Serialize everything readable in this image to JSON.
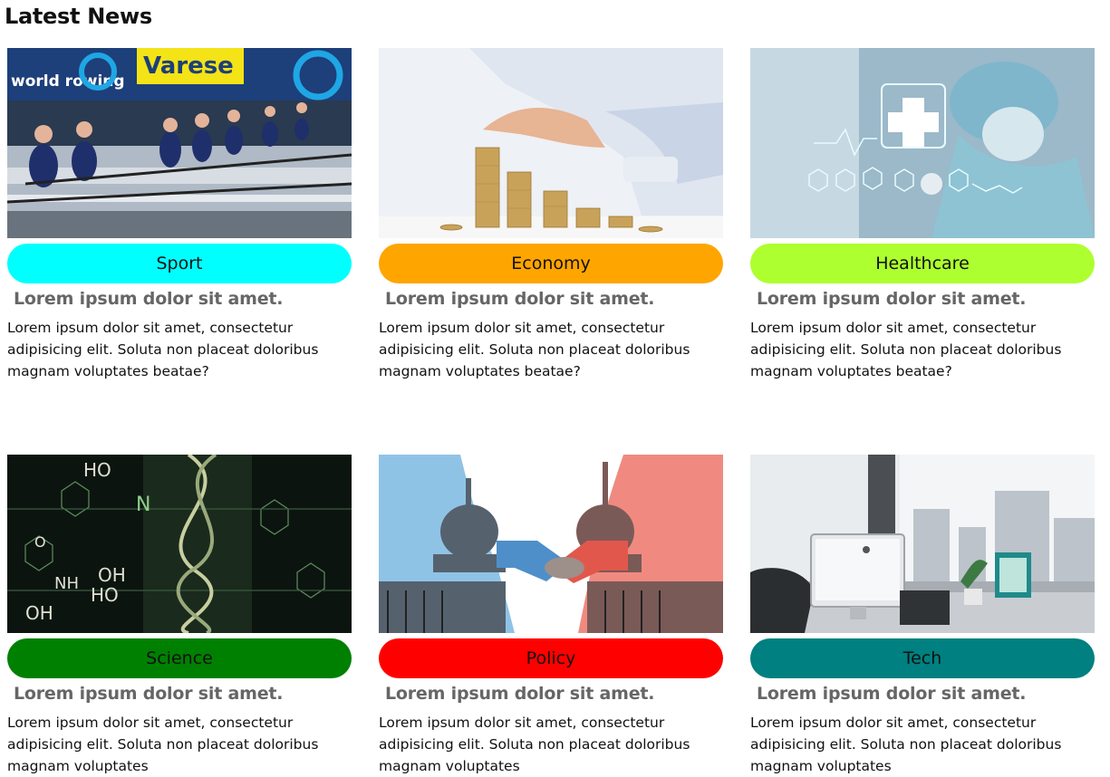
{
  "page": {
    "title": "Latest News"
  },
  "colors": {
    "sport": "#00ffff",
    "economy": "#ffa500",
    "healthcare": "#adff2f",
    "science": "#008000",
    "policy": "#ff0000",
    "tech": "#008080"
  },
  "articles": [
    {
      "category": "Sport",
      "image": "rowing-photo",
      "signage": {
        "left": "world rowing",
        "right": "Varese"
      },
      "headline": "Lorem ipsum dolor sit amet.",
      "body": "Lorem ipsum dolor sit amet, consectetur adipisicing elit. Soluta non placeat doloribus magnam voluptates beatae?"
    },
    {
      "category": "Economy",
      "image": "coin-stacks-photo",
      "headline": "Lorem ipsum dolor sit amet.",
      "body": "Lorem ipsum dolor sit amet, consectetur adipisicing elit. Soluta non placeat doloribus magnam voluptates beatae?"
    },
    {
      "category": "Healthcare",
      "image": "digital-health-photo",
      "headline": "Lorem ipsum dolor sit amet.",
      "body": "Lorem ipsum dolor sit amet, consectetur adipisicing elit. Soluta non placeat doloribus magnam voluptates beatae?"
    },
    {
      "category": "Science",
      "image": "molecules-dna-photo",
      "labels": [
        "HO",
        "N",
        "O",
        "OH",
        "NH",
        "HO",
        "OH"
      ],
      "headline": "Lorem ipsum dolor sit amet.",
      "body": "Lorem ipsum dolor sit amet, consectetur adipisicing elit. Soluta non placeat doloribus magnam voluptates"
    },
    {
      "category": "Policy",
      "image": "capitol-handshake-photo",
      "headline": "Lorem ipsum dolor sit amet.",
      "body": "Lorem ipsum dolor sit amet, consectetur adipisicing elit. Soluta non placeat doloribus magnam voluptates"
    },
    {
      "category": "Tech",
      "image": "office-desk-photo",
      "headline": "Lorem ipsum dolor sit amet.",
      "body": "Lorem ipsum dolor sit amet, consectetur adipisicing elit. Soluta non placeat doloribus magnam voluptates"
    }
  ]
}
